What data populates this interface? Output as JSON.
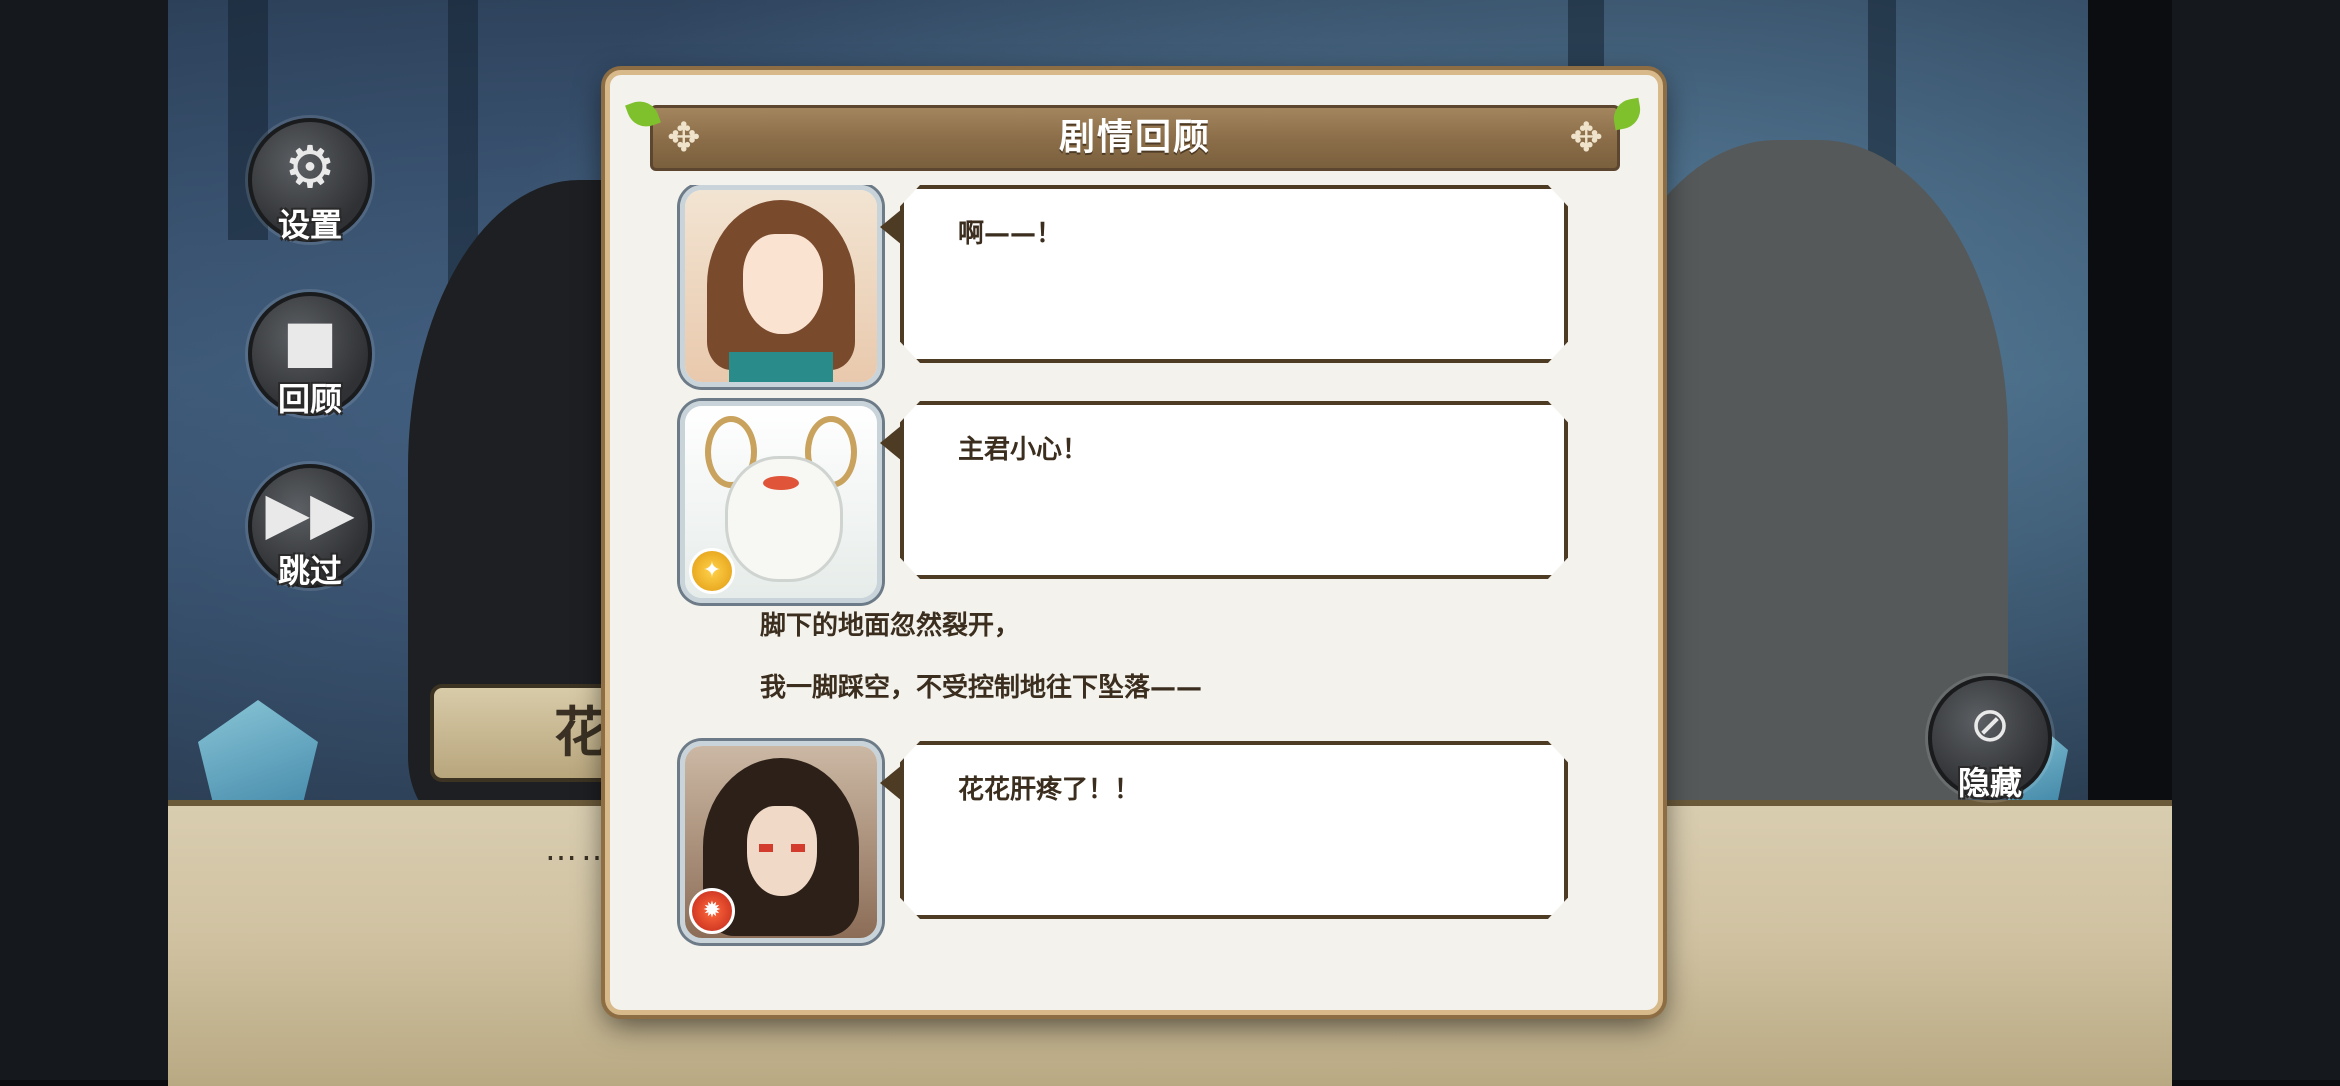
{
  "dialog": {
    "title": "剧情回顾"
  },
  "side_menu": {
    "settings": {
      "label": "设置",
      "icon": "gear-icon"
    },
    "review": {
      "label": "回顾",
      "icon": "camera-icon"
    },
    "skip": {
      "label": "跳过",
      "icon": "fast-forward-icon"
    }
  },
  "hide_button": {
    "label": "隐藏",
    "icon": "eye-slash-icon"
  },
  "scene": {
    "speaker_name": "花",
    "dialog_text": "……"
  },
  "log": [
    {
      "type": "speech",
      "avatar": "brown-haired-girl-portrait",
      "text": "啊——！"
    },
    {
      "type": "speech",
      "avatar": "white-dragon-portrait",
      "badge": "gold",
      "text": "主君小心！"
    },
    {
      "type": "narration",
      "text": "脚下的地面忽然裂开，"
    },
    {
      "type": "narration",
      "text": "我一脚踩空，不受控制地往下坠落——"
    },
    {
      "type": "speech",
      "avatar": "dark-haired-character-portrait",
      "badge": "red",
      "text": "花花肝疼了！！"
    }
  ],
  "colors": {
    "header_brown": "#8a6d48",
    "panel_bg": "#f3f2ed",
    "text_dark": "#3b2e1e"
  }
}
